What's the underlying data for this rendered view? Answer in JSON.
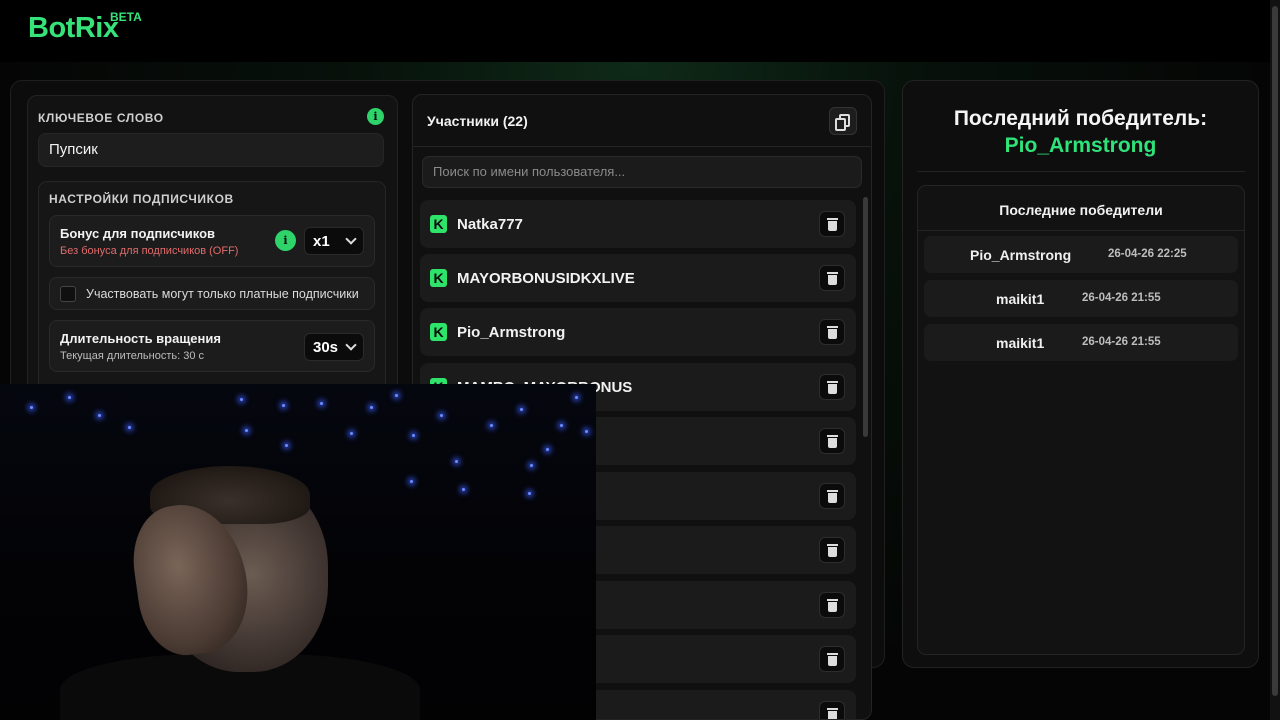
{
  "app": {
    "logo": "BotRix",
    "badge": "BETA"
  },
  "settings": {
    "keyword_label": "КЛЮЧЕВОЕ СЛОВО",
    "keyword_value": "Пупсик",
    "subscribers_section": "НАСТРОЙКИ ПОДПИСЧИКОВ",
    "bonus_title": "Бонус для подписчиков",
    "bonus_sub": "Без бонуса для подписчиков (OFF)",
    "bonus_value": "x1",
    "only_paid_label": "Участвовать могут только платные подписчики",
    "duration_title": "Длительность вращения",
    "duration_sub": "Текущая длительность: 30 с",
    "duration_value": "30s"
  },
  "participants": {
    "title": "Участники (22)",
    "search_placeholder": "Поиск по имени пользователя...",
    "items": [
      {
        "name": "Natka777"
      },
      {
        "name": "MAYORBONUSIDKXLIVE"
      },
      {
        "name": "Pio_Armstrong"
      },
      {
        "name": "MAMBO_MAYORBONUS"
      },
      {
        "name": ""
      },
      {
        "name": ""
      },
      {
        "name": ""
      },
      {
        "name": ""
      },
      {
        "name": ""
      },
      {
        "name": ""
      }
    ]
  },
  "winner": {
    "title": "Последний победитель:",
    "name": "Pio_Armstrong",
    "recent_title": "Последние победители",
    "recent": [
      {
        "name": "Pio_Armstrong",
        "time": "26-04-26 22:25"
      },
      {
        "name": "maikit1",
        "time": "26-04-26 21:55"
      },
      {
        "name": "maikit1",
        "time": "26-04-26 21:55"
      }
    ]
  },
  "colors": {
    "accent": "#2fe27a",
    "kick_green": "#2ee36a",
    "warning_text": "#e06b6b"
  }
}
